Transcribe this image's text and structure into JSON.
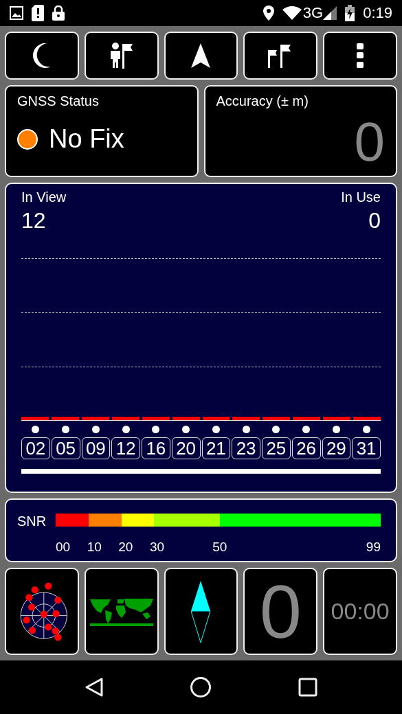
{
  "status_bar": {
    "network": "3G",
    "time": "0:19"
  },
  "fix_card": {
    "title": "GNSS Status",
    "value": "No Fix",
    "color": "#ff8000"
  },
  "accuracy_card": {
    "title": "Accuracy (± m)",
    "value": "0"
  },
  "satellites_panel": {
    "in_view_label": "In View",
    "in_view": "12",
    "in_use_label": "In Use",
    "in_use": "0",
    "satellites": [
      {
        "prn": "02"
      },
      {
        "prn": "05"
      },
      {
        "prn": "09"
      },
      {
        "prn": "12"
      },
      {
        "prn": "16"
      },
      {
        "prn": "20"
      },
      {
        "prn": "21"
      },
      {
        "prn": "23"
      },
      {
        "prn": "25"
      },
      {
        "prn": "26"
      },
      {
        "prn": "29"
      },
      {
        "prn": "31"
      }
    ]
  },
  "snr": {
    "label": "SNR",
    "segments": [
      {
        "color": "#ff0000"
      },
      {
        "color": "#ff8000"
      },
      {
        "color": "#ffff00"
      },
      {
        "color": "#a8ff00"
      },
      {
        "color": "#00ff00"
      }
    ],
    "ticks": [
      "00",
      "10",
      "20",
      "30",
      "50",
      "99"
    ]
  },
  "tiles": [
    {
      "kind": "sky_plot"
    },
    {
      "kind": "world_map"
    },
    {
      "kind": "compass"
    },
    {
      "kind": "number",
      "text": "0"
    },
    {
      "kind": "time",
      "text": "00:00"
    }
  ]
}
